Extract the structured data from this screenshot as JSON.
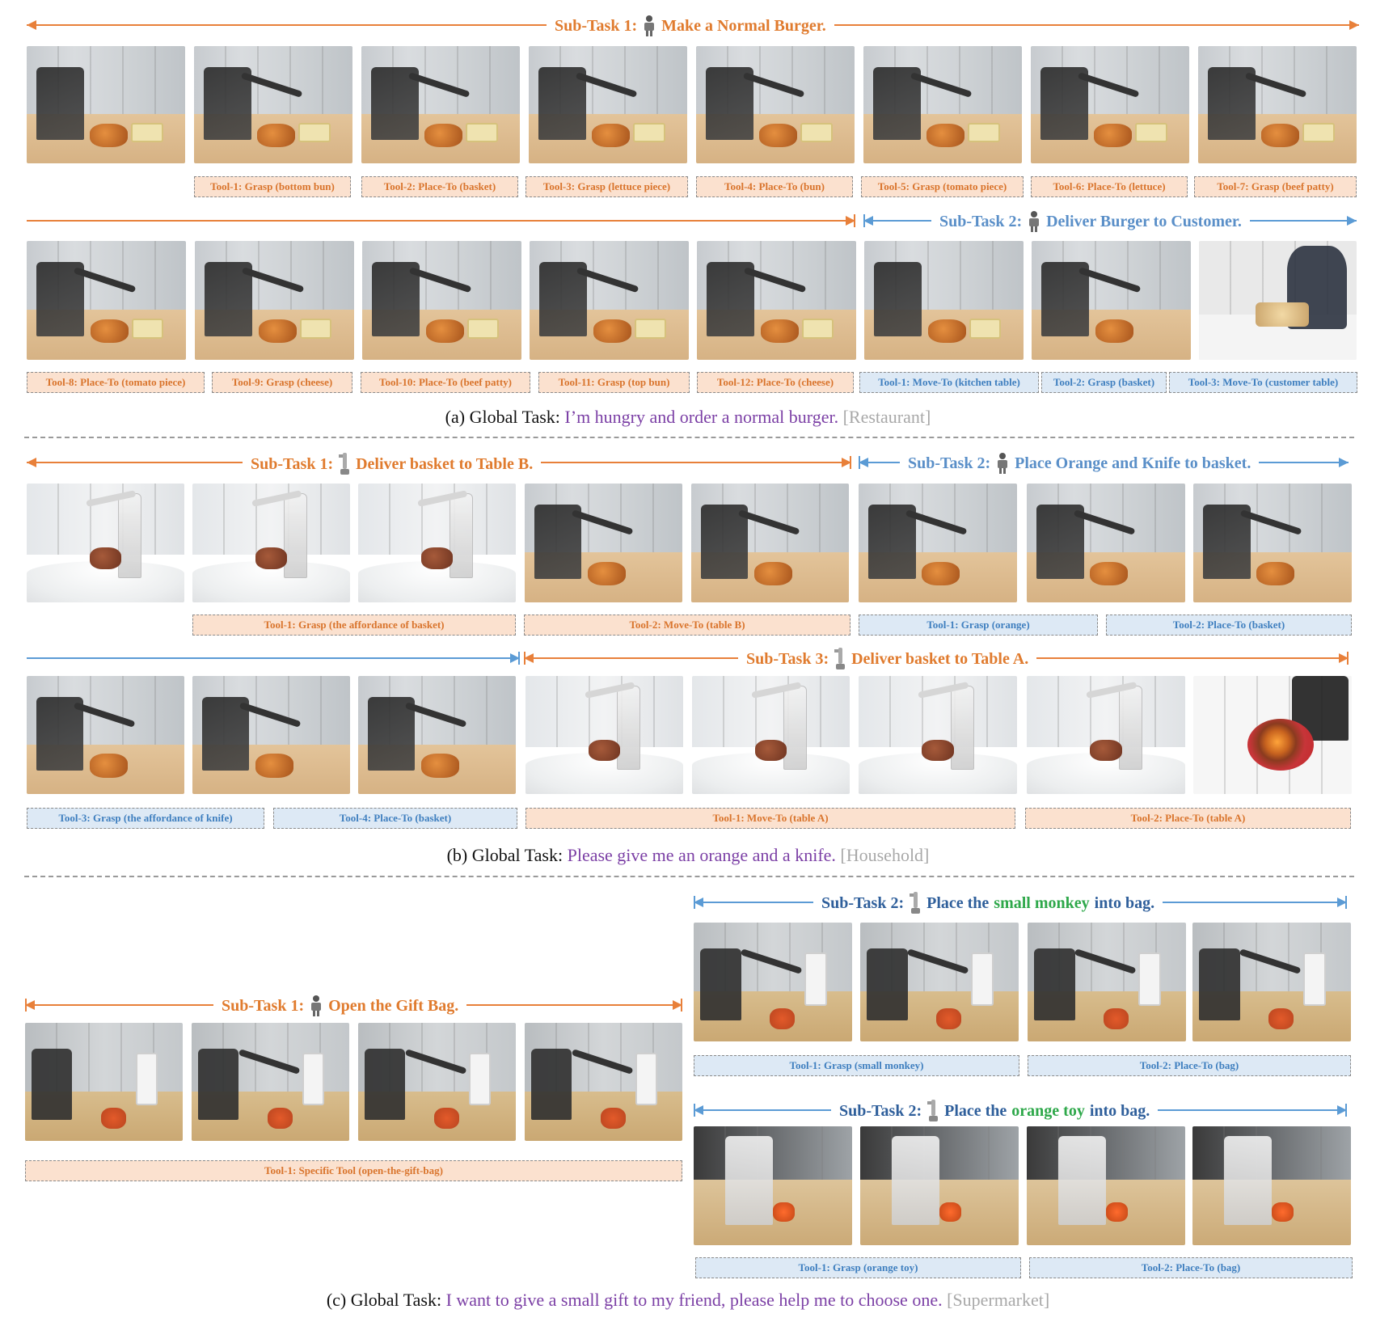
{
  "panel_a": {
    "subtask1": {
      "prefix": "Sub-Task 1:",
      "text": "Make a Normal Burger."
    },
    "subtask2": {
      "prefix": "Sub-Task 2:",
      "text": "Deliver Burger to Customer."
    },
    "tools_row1": [
      "Tool-1: Grasp (bottom bun)",
      "Tool-2: Place-To (basket)",
      "Tool-3: Grasp (lettuce piece)",
      "Tool-4: Place-To (bun)",
      "Tool-5: Grasp (tomato piece)",
      "Tool-6: Place-To (lettuce)",
      "Tool-7: Grasp (beef patty)"
    ],
    "tools_row2_orange": [
      "Tool-8: Place-To (tomato piece)",
      "Tool-9: Grasp (cheese)",
      "Tool-10: Place-To (beef patty)",
      "Tool-11: Grasp (top bun)",
      "Tool-12: Place-To (cheese)"
    ],
    "tools_row2_blue": [
      "Tool-1: Move-To (kitchen table)",
      "Tool-2: Grasp (basket)",
      "Tool-3: Move-To (customer table)"
    ],
    "caption": {
      "lead": "(a) Global Task: ",
      "query": "I’m hungry and order a normal burger.",
      "scene": "[Restaurant]"
    }
  },
  "panel_b": {
    "subtask1": {
      "prefix": "Sub-Task 1:",
      "text": "Deliver basket to Table B."
    },
    "subtask2": {
      "prefix": "Sub-Task 2:",
      "text": "Place Orange and Knife to basket."
    },
    "subtask3": {
      "prefix": "Sub-Task 3:",
      "text": "Deliver basket to Table A."
    },
    "tools_row1_orange": [
      "Tool-1: Grasp (the affordance of basket)",
      "Tool-2: Move-To (table B)"
    ],
    "tools_row1_blue": [
      "Tool-1: Grasp (orange)",
      "Tool-2: Place-To (basket)"
    ],
    "tools_row2_blue": [
      "Tool-3: Grasp (the affordance of knife)",
      "Tool-4: Place-To (basket)"
    ],
    "tools_row2_orange": [
      "Tool-1: Move-To (table A)",
      "Tool-2: Place-To (table A)"
    ],
    "caption": {
      "lead": "(b) Global Task: ",
      "query": "Please give me an orange and a knife.",
      "scene": "[Household]"
    }
  },
  "panel_c": {
    "subtask1": {
      "prefix": "Sub-Task 1:",
      "text": "Open the Gift Bag."
    },
    "subtask2a": {
      "prefix": "Sub-Task 2:",
      "pre": "Place the",
      "highlight": "small monkey",
      "post": "into bag."
    },
    "subtask2b": {
      "prefix": "Sub-Task 2:",
      "pre": "Place the",
      "highlight": "orange toy",
      "post": "into bag."
    },
    "tool_open": "Tool-1: Specific Tool (open-the-gift-bag)",
    "tools_monkey": [
      "Tool-1: Grasp (small monkey)",
      "Tool-2: Place-To (bag)"
    ],
    "tools_orange": [
      "Tool-1: Grasp (orange toy)",
      "Tool-2: Place-To (bag)"
    ],
    "caption": {
      "lead": "(c) Global Task: ",
      "query": "I want to give a small gift to my friend, please help me to choose one.",
      "scene": "[Supermarket]"
    }
  },
  "colors": {
    "orange": "#e07b2e",
    "blue": "#5a8fc8",
    "purple": "#7b3fa5",
    "green": "#2ea84a",
    "gray": "#a8a8a8"
  },
  "icons": [
    "humanoid-robot-icon",
    "robot-arm-icon"
  ]
}
